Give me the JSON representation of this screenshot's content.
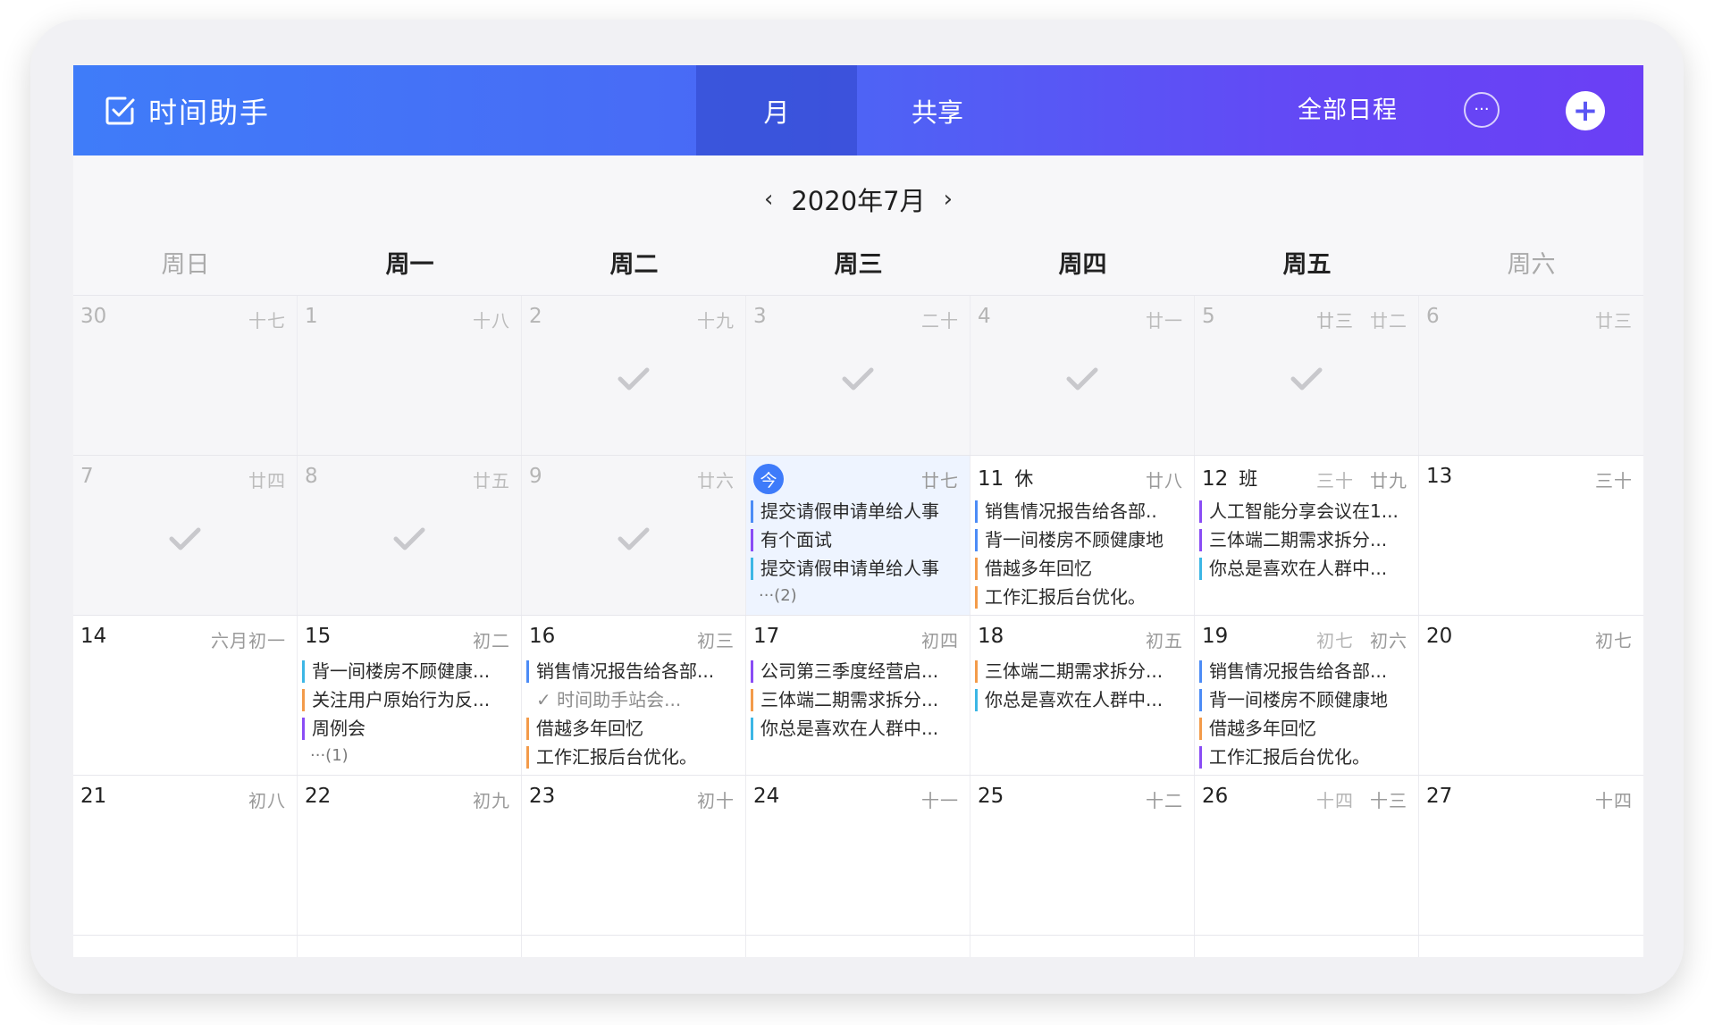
{
  "header": {
    "title": "时间助手",
    "tab_month": "月",
    "tab_share": "共享",
    "all_schedule": "全部日程",
    "more_label": "···",
    "add_label": "+"
  },
  "nav": {
    "prev": "‹",
    "month": "2020年7月",
    "next": "›"
  },
  "weekdays": [
    "周日",
    "周一",
    "周二",
    "周三",
    "周四",
    "周五",
    "周六"
  ],
  "today_label": "今",
  "weeks": [
    [
      {
        "day": "30",
        "lunar": "十七",
        "past": true
      },
      {
        "day": "1",
        "lunar": "十八",
        "past": true
      },
      {
        "day": "2",
        "lunar": "十九",
        "past": true,
        "check": true
      },
      {
        "day": "3",
        "lunar": "二十",
        "past": true,
        "check": true
      },
      {
        "day": "4",
        "lunar": "廿一",
        "past": true,
        "check": true
      },
      {
        "day": "5",
        "lunar": "廿二",
        "lunar_extra": "廿三",
        "past": true,
        "check": true
      },
      {
        "day": "6",
        "lunar": "廿三",
        "past": true
      }
    ],
    [
      {
        "day": "7",
        "lunar": "廿四",
        "past": true,
        "check": true
      },
      {
        "day": "8",
        "lunar": "廿五",
        "past": true,
        "check": true
      },
      {
        "day": "9",
        "lunar": "廿六",
        "past": true,
        "check": true
      },
      {
        "day": "",
        "lunar": "廿七",
        "today": true,
        "events": [
          {
            "text": "提交请假申请单给人事",
            "color": "blue"
          },
          {
            "text": "有个面试",
            "color": "purple"
          },
          {
            "text": "提交请假申请单给人事",
            "color": "cyan"
          }
        ],
        "more": "···(2)"
      },
      {
        "day": "11",
        "tag": "休",
        "lunar": "廿八",
        "events": [
          {
            "text": "销售情况报告给各部..",
            "color": "blue"
          },
          {
            "text": "背一间楼房不顾健康地",
            "color": "blue"
          },
          {
            "text": "借越多年回忆",
            "color": "orange"
          },
          {
            "text": "工作汇报后台优化。",
            "color": "orange"
          }
        ]
      },
      {
        "day": "12",
        "tag": "班",
        "lunar": "廿九",
        "lunar_extra": "三十",
        "events": [
          {
            "text": "人工智能分享会议在1...",
            "color": "purple"
          },
          {
            "text": "三体端二期需求拆分...",
            "color": "purple"
          },
          {
            "text": "你总是喜欢在人群中...",
            "color": "cyan"
          }
        ]
      },
      {
        "day": "13",
        "lunar": "三十"
      }
    ],
    [
      {
        "day": "14",
        "lunar": "六月初一"
      },
      {
        "day": "15",
        "lunar": "初二",
        "events": [
          {
            "text": "背一间楼房不顾健康...",
            "color": "cyan"
          },
          {
            "text": "关注用户原始行为反...",
            "color": "orange"
          },
          {
            "text": "周例会",
            "color": "purple"
          }
        ],
        "more": "···(1)"
      },
      {
        "day": "16",
        "lunar": "初三",
        "events": [
          {
            "text": "销售情况报告给各部...",
            "color": "blue"
          },
          {
            "text": "✓ 时间助手站会...",
            "color": "none",
            "done": true
          },
          {
            "text": "借越多年回忆",
            "color": "orange"
          },
          {
            "text": "工作汇报后台优化。",
            "color": "orange"
          }
        ]
      },
      {
        "day": "17",
        "lunar": "初四",
        "events": [
          {
            "text": "公司第三季度经营启...",
            "color": "purple"
          },
          {
            "text": "三体端二期需求拆分...",
            "color": "orange"
          },
          {
            "text": "你总是喜欢在人群中...",
            "color": "cyan"
          }
        ]
      },
      {
        "day": "18",
        "lunar": "初五",
        "events": [
          {
            "text": "三体端二期需求拆分...",
            "color": "orange"
          },
          {
            "text": "你总是喜欢在人群中...",
            "color": "cyan"
          }
        ]
      },
      {
        "day": "19",
        "lunar": "初六",
        "lunar_extra": "初七",
        "events": [
          {
            "text": "销售情况报告给各部...",
            "color": "blue"
          },
          {
            "text": "背一间楼房不顾健康地",
            "color": "blue"
          },
          {
            "text": "借越多年回忆",
            "color": "orange"
          },
          {
            "text": "工作汇报后台优化。",
            "color": "purple"
          }
        ]
      },
      {
        "day": "20",
        "lunar": "初七"
      }
    ],
    [
      {
        "day": "21",
        "lunar": "初八"
      },
      {
        "day": "22",
        "lunar": "初九"
      },
      {
        "day": "23",
        "lunar": "初十"
      },
      {
        "day": "24",
        "lunar": "十一"
      },
      {
        "day": "25",
        "lunar": "十二"
      },
      {
        "day": "26",
        "lunar": "十三",
        "lunar_extra": "十四"
      },
      {
        "day": "27",
        "lunar": "十四"
      }
    ]
  ],
  "colors": {
    "blue": "#4c8cf6",
    "purple": "#8a4cf5",
    "orange": "#f39b4a",
    "cyan": "#3cb6e5",
    "today": "#3e7bfa"
  }
}
